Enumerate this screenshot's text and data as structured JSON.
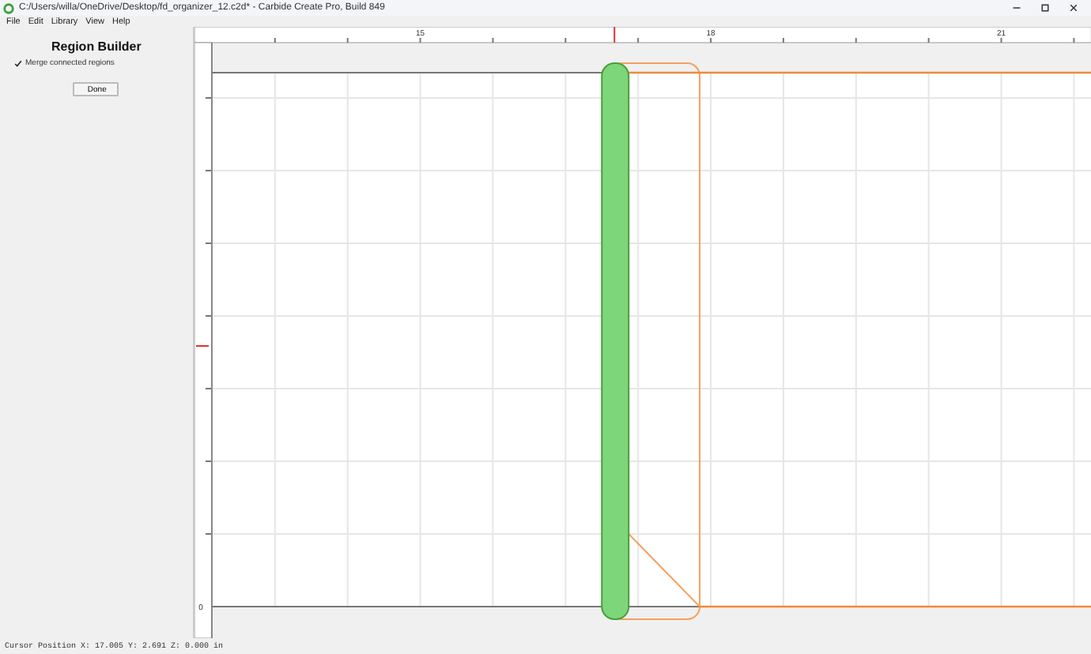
{
  "window": {
    "title": "C:/Users/willa/OneDrive/Desktop/fd_organizer_12.c2d* - Carbide Create Pro, Build 849"
  },
  "menu": [
    "File",
    "Edit",
    "Library",
    "View",
    "Help"
  ],
  "panel": {
    "title": "Region Builder",
    "option": {
      "label": "Merge connected regions",
      "checked": true
    },
    "button": "Done"
  },
  "rulers": {
    "x_labels": [
      "15",
      "18",
      "21"
    ],
    "y_labels": [
      "0"
    ]
  },
  "status_bar": "Cursor Position X: 17.005 Y: 2.691 Z: 0.000 in"
}
